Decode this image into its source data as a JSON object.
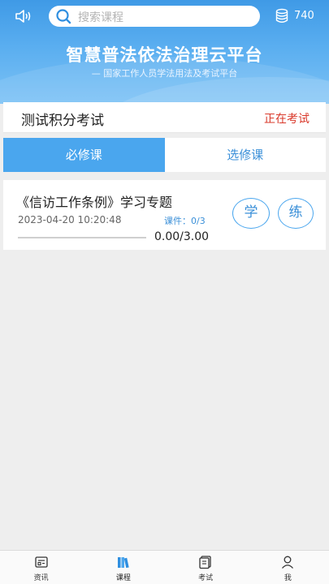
{
  "topbar": {
    "speaker_icon": "speaker-icon",
    "search_placeholder": "搜索课程",
    "coin_icon": "coin-stack-icon",
    "coin_count": "740"
  },
  "banner": {
    "title": "智慧普法依法治理云平台",
    "subtitle": "— 国家工作人员学法用法及考试平台"
  },
  "exam": {
    "name": "测试积分考试",
    "status": "正在考试",
    "status_color": "#d9392b"
  },
  "tabs": [
    {
      "label": "必修课",
      "active": true
    },
    {
      "label": "选修课",
      "active": false
    }
  ],
  "course": {
    "title": "《信访工作条例》学习专题",
    "date": "2023-04-20 10:20:48",
    "count": "课件：0/3",
    "score": "0.00/3.00",
    "progress": 0,
    "learn_label": "学",
    "practice_label": "练"
  },
  "bottom_nav": [
    {
      "label": "资讯",
      "icon": "news-icon",
      "active": false
    },
    {
      "label": "课程",
      "icon": "books-icon",
      "active": true
    },
    {
      "label": "考试",
      "icon": "exam-icon",
      "active": false
    },
    {
      "label": "我",
      "icon": "user-icon",
      "active": false
    }
  ],
  "colors": {
    "accent": "#4aa6ee",
    "header_top": "#3f9ae6"
  }
}
